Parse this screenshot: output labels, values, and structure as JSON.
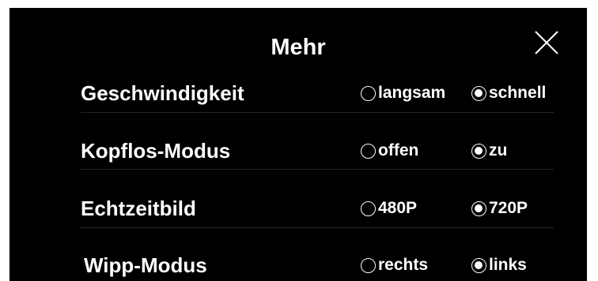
{
  "dialog": {
    "title": "Mehr",
    "close_icon": "close-icon"
  },
  "settings": [
    {
      "label": "Geschwindigkeit",
      "options": [
        {
          "label": "langsam",
          "checked": false
        },
        {
          "label": "schnell",
          "checked": true
        }
      ]
    },
    {
      "label": "Kopflos-Modus",
      "options": [
        {
          "label": "offen",
          "checked": false
        },
        {
          "label": "zu",
          "checked": true
        }
      ]
    },
    {
      "label": "Echtzeitbild",
      "options": [
        {
          "label": "480P",
          "checked": false
        },
        {
          "label": "720P",
          "checked": true
        }
      ]
    },
    {
      "label": "Wipp-Modus",
      "options": [
        {
          "label": "rechts",
          "checked": false
        },
        {
          "label": "links",
          "checked": true
        }
      ]
    }
  ],
  "colors": {
    "background": "#000000",
    "text": "#ffffff",
    "divider": "#262626"
  }
}
